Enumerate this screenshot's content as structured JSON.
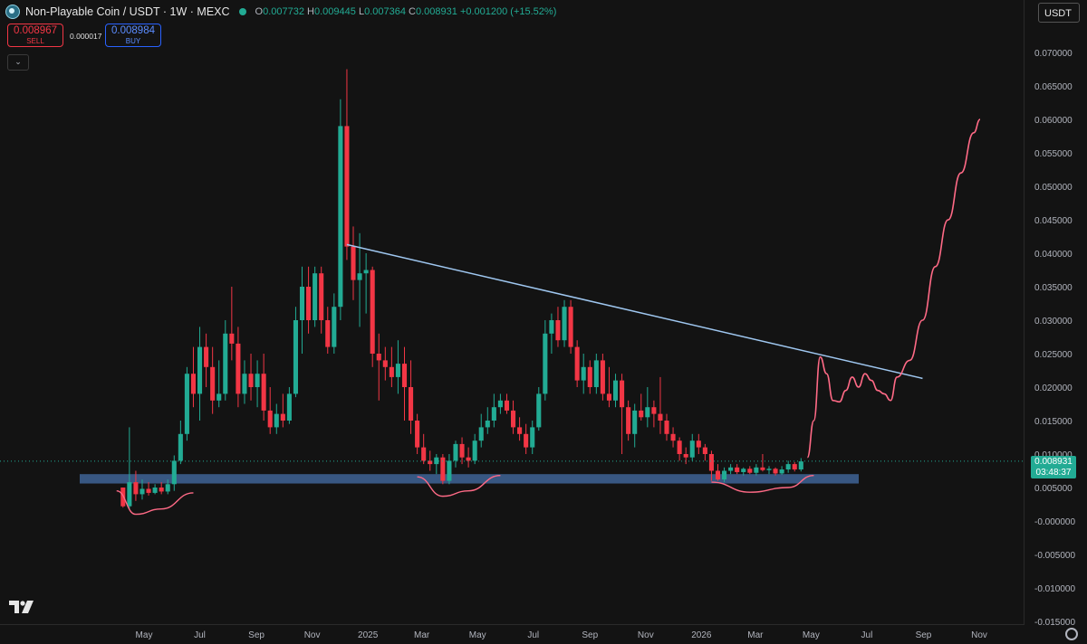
{
  "header": {
    "symbol": "Non-Playable Coin / USDT · 1W · MEXC",
    "o_label": "O",
    "o_value": "0.007732",
    "h_label": "H",
    "h_value": "0.009445",
    "l_label": "L",
    "l_value": "0.007364",
    "c_label": "C",
    "c_value": "0.008931",
    "change": "+0.001200 (+15.52%)"
  },
  "trade": {
    "sell_price": "0.008967",
    "sell_label": "SELL",
    "spread": "0.000017",
    "buy_price": "0.008984",
    "buy_label": "BUY"
  },
  "currency_selector": "USDT",
  "price_tag": {
    "price": "0.008931",
    "countdown": "03:48:37"
  },
  "colors": {
    "up": "#22ab94",
    "down": "#f23645",
    "trendline": "#9fc7f0",
    "projection": "#ff6a86",
    "support_zone": "#3d5f8f"
  },
  "chart_data": {
    "type": "candlestick",
    "timeframe": "1W",
    "yaxis": {
      "ticks": [
        "0.070000",
        "0.065000",
        "0.060000",
        "0.055000",
        "0.050000",
        "0.045000",
        "0.040000",
        "0.035000",
        "0.030000",
        "0.025000",
        "0.020000",
        "0.015000",
        "0.010000",
        "0.005000",
        "-0.000000",
        "-0.005000",
        "-0.010000",
        "-0.015000"
      ],
      "tick_values": [
        0.07,
        0.065,
        0.06,
        0.055,
        0.05,
        0.045,
        0.04,
        0.035,
        0.03,
        0.025,
        0.02,
        0.015,
        0.01,
        0.005,
        0,
        -0.005,
        -0.01,
        -0.015
      ],
      "ylim": [
        -0.0155,
        0.074
      ]
    },
    "xaxis": {
      "ticks": [
        "May",
        "Jul",
        "Sep",
        "Nov",
        "2025",
        "Mar",
        "May",
        "Jul",
        "Sep",
        "Nov",
        "2026",
        "Mar",
        "May",
        "Jul",
        "Sep",
        "Nov"
      ],
      "tick_dates": [
        "2024-05-01",
        "2024-07-01",
        "2024-09-01",
        "2024-11-01",
        "2025-01-01",
        "2025-03-01",
        "2025-05-01",
        "2025-07-01",
        "2025-09-01",
        "2025-11-01",
        "2026-01-01",
        "2026-03-01",
        "2026-05-01",
        "2026-07-01",
        "2026-09-01",
        "2026-11-01"
      ]
    },
    "candles": [
      {
        "date": "2024-04-08",
        "o": 0.005,
        "h": 0.005,
        "l": 0.002,
        "c": 0.0022
      },
      {
        "date": "2024-04-15",
        "o": 0.0022,
        "h": 0.014,
        "l": 0.0018,
        "c": 0.0058
      },
      {
        "date": "2024-04-22",
        "o": 0.0058,
        "h": 0.0075,
        "l": 0.003,
        "c": 0.004
      },
      {
        "date": "2024-04-29",
        "o": 0.004,
        "h": 0.0062,
        "l": 0.0032,
        "c": 0.0048
      },
      {
        "date": "2024-05-06",
        "o": 0.0048,
        "h": 0.0058,
        "l": 0.0038,
        "c": 0.0042
      },
      {
        "date": "2024-05-13",
        "o": 0.0042,
        "h": 0.0055,
        "l": 0.004,
        "c": 0.005
      },
      {
        "date": "2024-05-20",
        "o": 0.005,
        "h": 0.0058,
        "l": 0.004,
        "c": 0.0044
      },
      {
        "date": "2024-05-27",
        "o": 0.0044,
        "h": 0.0062,
        "l": 0.004,
        "c": 0.0055
      },
      {
        "date": "2024-06-03",
        "o": 0.0055,
        "h": 0.0098,
        "l": 0.0045,
        "c": 0.009
      },
      {
        "date": "2024-06-10",
        "o": 0.009,
        "h": 0.015,
        "l": 0.0085,
        "c": 0.013
      },
      {
        "date": "2024-06-17",
        "o": 0.013,
        "h": 0.023,
        "l": 0.012,
        "c": 0.022
      },
      {
        "date": "2024-06-24",
        "o": 0.022,
        "h": 0.026,
        "l": 0.017,
        "c": 0.019
      },
      {
        "date": "2024-07-01",
        "o": 0.019,
        "h": 0.029,
        "l": 0.015,
        "c": 0.026
      },
      {
        "date": "2024-07-08",
        "o": 0.026,
        "h": 0.028,
        "l": 0.02,
        "c": 0.023
      },
      {
        "date": "2024-07-15",
        "o": 0.023,
        "h": 0.026,
        "l": 0.016,
        "c": 0.018
      },
      {
        "date": "2024-07-22",
        "o": 0.018,
        "h": 0.024,
        "l": 0.017,
        "c": 0.019
      },
      {
        "date": "2024-07-29",
        "o": 0.019,
        "h": 0.03,
        "l": 0.018,
        "c": 0.028
      },
      {
        "date": "2024-08-05",
        "o": 0.028,
        "h": 0.035,
        "l": 0.024,
        "c": 0.0265
      },
      {
        "date": "2024-08-12",
        "o": 0.0265,
        "h": 0.029,
        "l": 0.017,
        "c": 0.019
      },
      {
        "date": "2024-08-19",
        "o": 0.019,
        "h": 0.024,
        "l": 0.0175,
        "c": 0.022
      },
      {
        "date": "2024-08-26",
        "o": 0.022,
        "h": 0.025,
        "l": 0.018,
        "c": 0.02
      },
      {
        "date": "2024-09-02",
        "o": 0.02,
        "h": 0.024,
        "l": 0.017,
        "c": 0.022
      },
      {
        "date": "2024-09-09",
        "o": 0.022,
        "h": 0.025,
        "l": 0.015,
        "c": 0.0165
      },
      {
        "date": "2024-09-16",
        "o": 0.0165,
        "h": 0.02,
        "l": 0.013,
        "c": 0.014
      },
      {
        "date": "2024-09-23",
        "o": 0.014,
        "h": 0.0175,
        "l": 0.013,
        "c": 0.016
      },
      {
        "date": "2024-09-30",
        "o": 0.016,
        "h": 0.019,
        "l": 0.014,
        "c": 0.015
      },
      {
        "date": "2024-10-07",
        "o": 0.015,
        "h": 0.02,
        "l": 0.0145,
        "c": 0.019
      },
      {
        "date": "2024-10-14",
        "o": 0.019,
        "h": 0.032,
        "l": 0.0185,
        "c": 0.03
      },
      {
        "date": "2024-10-21",
        "o": 0.03,
        "h": 0.038,
        "l": 0.025,
        "c": 0.035
      },
      {
        "date": "2024-10-28",
        "o": 0.035,
        "h": 0.038,
        "l": 0.028,
        "c": 0.03
      },
      {
        "date": "2024-11-04",
        "o": 0.03,
        "h": 0.038,
        "l": 0.029,
        "c": 0.037
      },
      {
        "date": "2024-11-11",
        "o": 0.037,
        "h": 0.038,
        "l": 0.028,
        "c": 0.03
      },
      {
        "date": "2024-11-18",
        "o": 0.03,
        "h": 0.032,
        "l": 0.025,
        "c": 0.026
      },
      {
        "date": "2024-11-25",
        "o": 0.026,
        "h": 0.034,
        "l": 0.025,
        "c": 0.032
      },
      {
        "date": "2024-12-02",
        "o": 0.032,
        "h": 0.063,
        "l": 0.03,
        "c": 0.059
      },
      {
        "date": "2024-12-09",
        "o": 0.059,
        "h": 0.0675,
        "l": 0.039,
        "c": 0.041
      },
      {
        "date": "2024-12-16",
        "o": 0.041,
        "h": 0.044,
        "l": 0.033,
        "c": 0.036
      },
      {
        "date": "2024-12-23",
        "o": 0.036,
        "h": 0.043,
        "l": 0.029,
        "c": 0.037
      },
      {
        "date": "2024-12-30",
        "o": 0.037,
        "h": 0.04,
        "l": 0.031,
        "c": 0.0375
      },
      {
        "date": "2025-01-06",
        "o": 0.0375,
        "h": 0.038,
        "l": 0.023,
        "c": 0.025
      },
      {
        "date": "2025-01-13",
        "o": 0.025,
        "h": 0.028,
        "l": 0.018,
        "c": 0.024
      },
      {
        "date": "2025-01-20",
        "o": 0.024,
        "h": 0.026,
        "l": 0.021,
        "c": 0.023
      },
      {
        "date": "2025-01-27",
        "o": 0.023,
        "h": 0.026,
        "l": 0.02,
        "c": 0.0215
      },
      {
        "date": "2025-02-03",
        "o": 0.0215,
        "h": 0.027,
        "l": 0.019,
        "c": 0.0235
      },
      {
        "date": "2025-02-10",
        "o": 0.0235,
        "h": 0.026,
        "l": 0.015,
        "c": 0.02
      },
      {
        "date": "2025-02-17",
        "o": 0.02,
        "h": 0.024,
        "l": 0.013,
        "c": 0.015
      },
      {
        "date": "2025-02-24",
        "o": 0.015,
        "h": 0.016,
        "l": 0.01,
        "c": 0.011
      },
      {
        "date": "2025-03-03",
        "o": 0.011,
        "h": 0.013,
        "l": 0.0085,
        "c": 0.009
      },
      {
        "date": "2025-03-10",
        "o": 0.009,
        "h": 0.0105,
        "l": 0.0075,
        "c": 0.0085
      },
      {
        "date": "2025-03-17",
        "o": 0.0085,
        "h": 0.01,
        "l": 0.007,
        "c": 0.0095
      },
      {
        "date": "2025-03-24",
        "o": 0.0095,
        "h": 0.01,
        "l": 0.0055,
        "c": 0.006
      },
      {
        "date": "2025-03-31",
        "o": 0.006,
        "h": 0.01,
        "l": 0.0055,
        "c": 0.009
      },
      {
        "date": "2025-04-07",
        "o": 0.009,
        "h": 0.012,
        "l": 0.008,
        "c": 0.0115
      },
      {
        "date": "2025-04-14",
        "o": 0.0115,
        "h": 0.0125,
        "l": 0.0085,
        "c": 0.0095
      },
      {
        "date": "2025-04-21",
        "o": 0.0095,
        "h": 0.011,
        "l": 0.008,
        "c": 0.009
      },
      {
        "date": "2025-04-28",
        "o": 0.009,
        "h": 0.013,
        "l": 0.0085,
        "c": 0.012
      },
      {
        "date": "2025-05-05",
        "o": 0.012,
        "h": 0.016,
        "l": 0.011,
        "c": 0.014
      },
      {
        "date": "2025-05-12",
        "o": 0.014,
        "h": 0.017,
        "l": 0.013,
        "c": 0.015
      },
      {
        "date": "2025-05-19",
        "o": 0.015,
        "h": 0.019,
        "l": 0.014,
        "c": 0.017
      },
      {
        "date": "2025-05-26",
        "o": 0.017,
        "h": 0.019,
        "l": 0.016,
        "c": 0.018
      },
      {
        "date": "2025-06-02",
        "o": 0.018,
        "h": 0.019,
        "l": 0.016,
        "c": 0.0165
      },
      {
        "date": "2025-06-09",
        "o": 0.0165,
        "h": 0.018,
        "l": 0.013,
        "c": 0.014
      },
      {
        "date": "2025-06-16",
        "o": 0.014,
        "h": 0.0155,
        "l": 0.012,
        "c": 0.013
      },
      {
        "date": "2025-06-23",
        "o": 0.013,
        "h": 0.0145,
        "l": 0.01,
        "c": 0.011
      },
      {
        "date": "2025-06-30",
        "o": 0.011,
        "h": 0.015,
        "l": 0.01,
        "c": 0.014
      },
      {
        "date": "2025-07-07",
        "o": 0.014,
        "h": 0.02,
        "l": 0.0135,
        "c": 0.019
      },
      {
        "date": "2025-07-14",
        "o": 0.019,
        "h": 0.03,
        "l": 0.018,
        "c": 0.028
      },
      {
        "date": "2025-07-21",
        "o": 0.028,
        "h": 0.031,
        "l": 0.025,
        "c": 0.03
      },
      {
        "date": "2025-07-28",
        "o": 0.03,
        "h": 0.032,
        "l": 0.026,
        "c": 0.027
      },
      {
        "date": "2025-08-04",
        "o": 0.027,
        "h": 0.033,
        "l": 0.026,
        "c": 0.032
      },
      {
        "date": "2025-08-11",
        "o": 0.032,
        "h": 0.033,
        "l": 0.025,
        "c": 0.026
      },
      {
        "date": "2025-08-18",
        "o": 0.026,
        "h": 0.027,
        "l": 0.02,
        "c": 0.021
      },
      {
        "date": "2025-08-25",
        "o": 0.021,
        "h": 0.025,
        "l": 0.019,
        "c": 0.023
      },
      {
        "date": "2025-09-01",
        "o": 0.023,
        "h": 0.024,
        "l": 0.019,
        "c": 0.02
      },
      {
        "date": "2025-09-08",
        "o": 0.02,
        "h": 0.025,
        "l": 0.019,
        "c": 0.024
      },
      {
        "date": "2025-09-15",
        "o": 0.024,
        "h": 0.025,
        "l": 0.018,
        "c": 0.019
      },
      {
        "date": "2025-09-22",
        "o": 0.019,
        "h": 0.023,
        "l": 0.017,
        "c": 0.018
      },
      {
        "date": "2025-09-29",
        "o": 0.018,
        "h": 0.022,
        "l": 0.017,
        "c": 0.021
      },
      {
        "date": "2025-10-06",
        "o": 0.021,
        "h": 0.022,
        "l": 0.01,
        "c": 0.017
      },
      {
        "date": "2025-10-13",
        "o": 0.017,
        "h": 0.018,
        "l": 0.012,
        "c": 0.013
      },
      {
        "date": "2025-10-20",
        "o": 0.013,
        "h": 0.0175,
        "l": 0.011,
        "c": 0.0165
      },
      {
        "date": "2025-10-27",
        "o": 0.0165,
        "h": 0.019,
        "l": 0.015,
        "c": 0.0155
      },
      {
        "date": "2025-11-03",
        "o": 0.0155,
        "h": 0.02,
        "l": 0.014,
        "c": 0.017
      },
      {
        "date": "2025-11-10",
        "o": 0.017,
        "h": 0.018,
        "l": 0.014,
        "c": 0.016
      },
      {
        "date": "2025-11-17",
        "o": 0.016,
        "h": 0.0215,
        "l": 0.013,
        "c": 0.015
      },
      {
        "date": "2025-11-24",
        "o": 0.015,
        "h": 0.016,
        "l": 0.012,
        "c": 0.013
      },
      {
        "date": "2025-12-01",
        "o": 0.013,
        "h": 0.014,
        "l": 0.011,
        "c": 0.012
      },
      {
        "date": "2025-12-08",
        "o": 0.012,
        "h": 0.0125,
        "l": 0.009,
        "c": 0.01
      },
      {
        "date": "2025-12-15",
        "o": 0.01,
        "h": 0.011,
        "l": 0.0085,
        "c": 0.0095
      },
      {
        "date": "2025-12-22",
        "o": 0.0095,
        "h": 0.013,
        "l": 0.009,
        "c": 0.012
      },
      {
        "date": "2025-12-29",
        "o": 0.012,
        "h": 0.013,
        "l": 0.01,
        "c": 0.011
      },
      {
        "date": "2026-01-05",
        "o": 0.011,
        "h": 0.0115,
        "l": 0.009,
        "c": 0.01
      },
      {
        "date": "2026-01-12",
        "o": 0.01,
        "h": 0.0105,
        "l": 0.006,
        "c": 0.0075
      },
      {
        "date": "2026-01-19",
        "o": 0.0075,
        "h": 0.0085,
        "l": 0.006,
        "c": 0.0062
      },
      {
        "date": "2026-01-26",
        "o": 0.0062,
        "h": 0.008,
        "l": 0.0058,
        "c": 0.0075
      },
      {
        "date": "2026-02-02",
        "o": 0.0075,
        "h": 0.0085,
        "l": 0.007,
        "c": 0.008
      },
      {
        "date": "2026-02-09",
        "o": 0.008,
        "h": 0.0085,
        "l": 0.007,
        "c": 0.0073
      },
      {
        "date": "2026-02-16",
        "o": 0.0073,
        "h": 0.008,
        "l": 0.0068,
        "c": 0.0078
      },
      {
        "date": "2026-02-23",
        "o": 0.0078,
        "h": 0.0082,
        "l": 0.007,
        "c": 0.0072
      },
      {
        "date": "2026-03-02",
        "o": 0.0072,
        "h": 0.0085,
        "l": 0.0068,
        "c": 0.008
      },
      {
        "date": "2026-03-09",
        "o": 0.008,
        "h": 0.01,
        "l": 0.0074,
        "c": 0.0076
      },
      {
        "date": "2026-03-16",
        "o": 0.0076,
        "h": 0.0082,
        "l": 0.007,
        "c": 0.0078
      },
      {
        "date": "2026-03-23",
        "o": 0.0078,
        "h": 0.008,
        "l": 0.0068,
        "c": 0.0071
      },
      {
        "date": "2026-03-30",
        "o": 0.0071,
        "h": 0.0082,
        "l": 0.0069,
        "c": 0.0077
      },
      {
        "date": "2026-04-06",
        "o": 0.0077,
        "h": 0.009,
        "l": 0.0072,
        "c": 0.0085
      },
      {
        "date": "2026-04-13",
        "o": 0.0085,
        "h": 0.0088,
        "l": 0.0074,
        "c": 0.0077
      },
      {
        "date": "2026-04-20",
        "o": 0.0077,
        "h": 0.0094,
        "l": 0.0074,
        "c": 0.0089
      }
    ],
    "support_zone": {
      "from": 0.0056,
      "to": 0.007
    },
    "trendline": [
      {
        "date": "2024-12-09",
        "y": 0.0413
      },
      {
        "date": "2026-08-31",
        "y": 0.0213
      }
    ],
    "projection_path": [
      {
        "date": "2026-04-27",
        "y": 0.0095
      },
      {
        "date": "2026-05-04",
        "y": 0.015
      },
      {
        "date": "2026-05-11",
        "y": 0.0245
      },
      {
        "date": "2026-05-18",
        "y": 0.022
      },
      {
        "date": "2026-05-25",
        "y": 0.018
      },
      {
        "date": "2026-06-01",
        "y": 0.0178
      },
      {
        "date": "2026-06-08",
        "y": 0.0195
      },
      {
        "date": "2026-06-15",
        "y": 0.0215
      },
      {
        "date": "2026-06-22",
        "y": 0.02
      },
      {
        "date": "2026-06-29",
        "y": 0.022
      },
      {
        "date": "2026-07-06",
        "y": 0.021
      },
      {
        "date": "2026-07-13",
        "y": 0.0195
      },
      {
        "date": "2026-07-20",
        "y": 0.019
      },
      {
        "date": "2026-07-27",
        "y": 0.018
      },
      {
        "date": "2026-08-03",
        "y": 0.0215
      },
      {
        "date": "2026-08-17",
        "y": 0.024
      },
      {
        "date": "2026-08-31",
        "y": 0.03
      },
      {
        "date": "2026-09-14",
        "y": 0.038
      },
      {
        "date": "2026-09-28",
        "y": 0.045
      },
      {
        "date": "2026-10-12",
        "y": 0.052
      },
      {
        "date": "2026-10-26",
        "y": 0.058
      },
      {
        "date": "2026-11-02",
        "y": 0.06
      }
    ],
    "bottom_arcs": [
      [
        {
          "date": "2024-04-01",
          "y": 0.0045
        },
        {
          "date": "2024-04-22",
          "y": 0.001
        },
        {
          "date": "2024-05-20",
          "y": 0.0018
        },
        {
          "date": "2024-06-24",
          "y": 0.0042
        }
      ],
      [
        {
          "date": "2025-02-24",
          "y": 0.0066
        },
        {
          "date": "2025-03-24",
          "y": 0.0037
        },
        {
          "date": "2025-04-21",
          "y": 0.0045
        },
        {
          "date": "2025-05-26",
          "y": 0.0068
        }
      ],
      [
        {
          "date": "2026-01-12",
          "y": 0.0058
        },
        {
          "date": "2026-02-23",
          "y": 0.0043
        },
        {
          "date": "2026-04-06",
          "y": 0.005
        },
        {
          "date": "2026-05-04",
          "y": 0.0068
        }
      ]
    ],
    "last_price": 0.008931,
    "grid": false
  }
}
